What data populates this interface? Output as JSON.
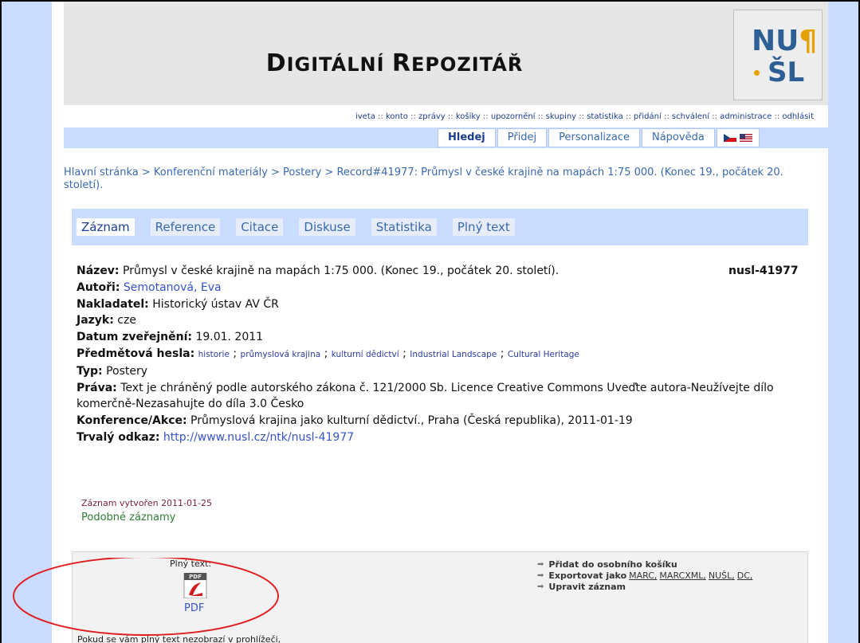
{
  "header": {
    "site_title_first": "D",
    "site_title_rest_1": "IGITÁLNÍ",
    "site_title_second_first": "R",
    "site_title_rest_2": "EPOZITÁŘ",
    "logo_top": "NU",
    "logo_top_mark": "¶",
    "logo_bottom": "ŠL"
  },
  "util_nav": [
    "iveta",
    "konto",
    "zprávy",
    "košíky",
    "upozornění",
    "skupiny",
    "statistika",
    "přidání",
    "schválení",
    "administrace",
    "odhlásit"
  ],
  "main_tabs": [
    {
      "label": "Hledej",
      "active": true
    },
    {
      "label": "Přidej",
      "active": false
    },
    {
      "label": "Personalizace",
      "active": false
    },
    {
      "label": "Nápověda",
      "active": false
    }
  ],
  "breadcrumb": "Hlavní stránka > Konferenční materiály > Postery > Record#41977: Průmysl v české krajině na mapách 1:75 000. (Konec 19., počátek 20. století).",
  "record_tabs": [
    {
      "label": "Záznam",
      "active": true
    },
    {
      "label": "Reference",
      "active": false
    },
    {
      "label": "Citace",
      "active": false
    },
    {
      "label": "Diskuse",
      "active": false
    },
    {
      "label": "Statistika",
      "active": false
    },
    {
      "label": "Plný text",
      "active": false
    }
  ],
  "record": {
    "id": "nusl-41977",
    "title_label": "Název:",
    "title": "Průmysl v české krajině na mapách 1:75 000. (Konec 19., počátek 20. století).",
    "authors_label": "Autoři:",
    "authors": "Semotanová, Eva",
    "publisher_label": "Nakladatel:",
    "publisher": "Historický ústav AV ČR",
    "language_label": "Jazyk:",
    "language": "cze",
    "date_label": "Datum zveřejnění:",
    "date": "19.01. 2011",
    "subjects_label": "Předmětová hesla:",
    "subjects": [
      "historie",
      "průmyslová krajina",
      "kulturní dědictví",
      "Industrial Landscape",
      "Cultural Heritage"
    ],
    "type_label": "Typ:",
    "type": "Postery",
    "rights_label": "Práva:",
    "rights": "Text je chráněný podle autorského zákona č. 121/2000 Sb. Licence Creative Commons Uveďte autora-Neužívejte dílo komerčně-Nezasahujte do díla 3.0 Česko",
    "conference_label": "Konference/Akce:",
    "conference": "Průmyslová krajina jako kulturní dědictví., Praha (Česká republika), 2011-01-19",
    "permalink_label": "Trvalý odkaz:",
    "permalink": "http://www.nusl.cz/ntk/nusl-41977"
  },
  "created": "Záznam vytvořen 2011-01-25",
  "similar": "Podobné záznamy",
  "fulltext": {
    "label": "Plný text:",
    "pdf_link": "PDF",
    "icon_text": "PDF",
    "note": "Pokud se vám plný text nezobrazí v prohlížeči,"
  },
  "actions": {
    "add_to_basket": "Přidat do osobního košíku",
    "export_as": "Exportovat jako",
    "export_formats": [
      "MARC",
      "MARCXML",
      "NUŠL",
      "DC"
    ],
    "edit": "Upravit záznam"
  },
  "colors": {
    "side": "#cadcff",
    "header": "#e6e6e6",
    "link": "#3653c8",
    "annotation": "#e02020"
  }
}
